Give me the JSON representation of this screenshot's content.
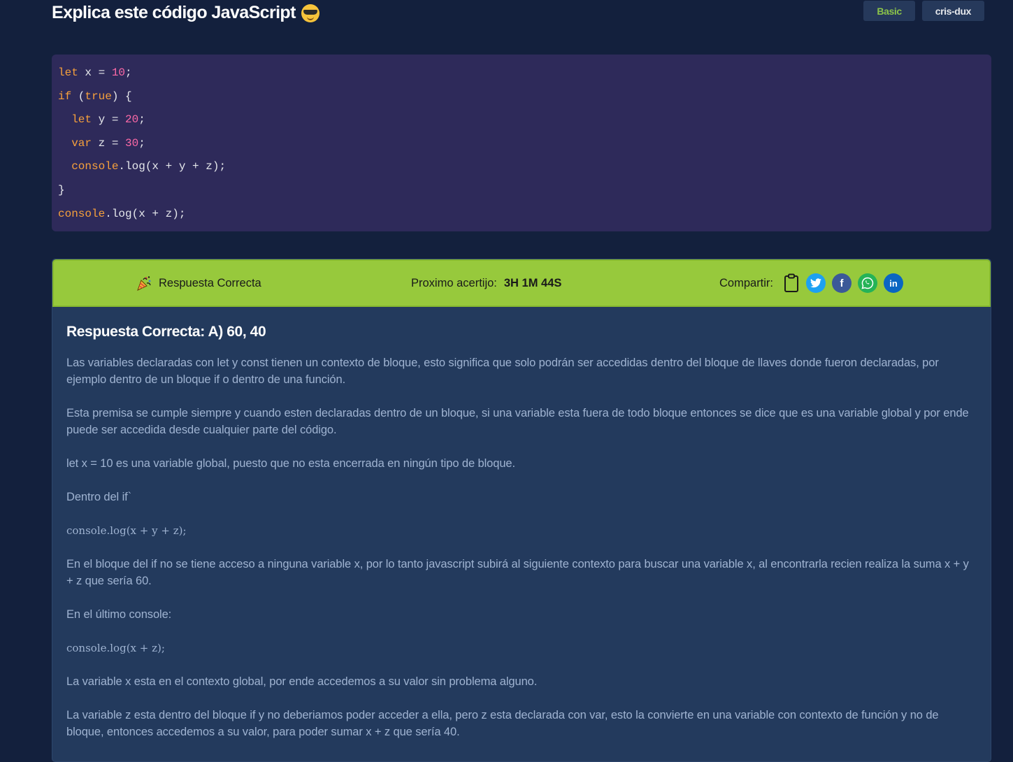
{
  "header": {
    "title": "Explica este código JavaScript",
    "level_badge": "Basic",
    "user_badge": "cris-dux"
  },
  "code": {
    "lines": [
      [
        {
          "t": "let",
          "c": "kw"
        },
        {
          "t": " x = "
        },
        {
          "t": "10",
          "c": "num"
        },
        {
          "t": ";"
        }
      ],
      [
        {
          "t": "if",
          "c": "kw"
        },
        {
          "t": " ("
        },
        {
          "t": "true",
          "c": "kw"
        },
        {
          "t": ") {"
        }
      ],
      [
        {
          "t": "  "
        },
        {
          "t": "let",
          "c": "kw"
        },
        {
          "t": " y = "
        },
        {
          "t": "20",
          "c": "num"
        },
        {
          "t": ";"
        }
      ],
      [
        {
          "t": "  "
        },
        {
          "t": "var",
          "c": "kw"
        },
        {
          "t": " z = "
        },
        {
          "t": "30",
          "c": "num"
        },
        {
          "t": ";"
        }
      ],
      [
        {
          "t": "  "
        },
        {
          "t": "console",
          "c": "obj"
        },
        {
          "t": ".log(x + y + z);"
        }
      ],
      [
        {
          "t": "}"
        }
      ],
      [
        {
          "t": "console",
          "c": "obj"
        },
        {
          "t": ".log(x + z);"
        }
      ]
    ]
  },
  "result_bar": {
    "status": "Respuesta Correcta",
    "next_label": "Proximo acertijo:",
    "countdown": "3H 1M 44S",
    "share_label": "Compartir:",
    "twitter": "t",
    "facebook": "f",
    "linkedin": "in"
  },
  "explanation": {
    "title": "Respuesta Correcta: A) 60, 40",
    "blocks": [
      {
        "type": "p",
        "text": "Las variables declaradas con let y const tienen un contexto de bloque, esto significa que solo podrán ser accedidas dentro del bloque de llaves donde fueron declaradas, por ejemplo dentro de un bloque if o dentro de una función."
      },
      {
        "type": "p",
        "text": "Esta premisa se cumple siempre y cuando esten declaradas dentro de un bloque, si una variable esta fuera de todo bloque entonces se dice que es una variable global y por ende puede ser accedida desde cualquier parte del código."
      },
      {
        "type": "p",
        "text": "let x = 10 es una variable global, puesto que no esta encerrada en ningún tipo de bloque."
      },
      {
        "type": "p",
        "text": "Dentro del if`"
      },
      {
        "type": "code",
        "text": "console.log(x + y + z);"
      },
      {
        "type": "p",
        "text": "En el bloque del if no se tiene acceso a ninguna variable x, por lo tanto javascript subirá al siguiente contexto para buscar una variable x, al encontrarla recien realiza la suma x + y + z que sería 60."
      },
      {
        "type": "p",
        "text": "En el último console:"
      },
      {
        "type": "code",
        "text": "console.log(x + z);"
      },
      {
        "type": "p",
        "text": "La variable x esta en el contexto global, por ende accedemos a su valor sin problema alguno."
      },
      {
        "type": "p",
        "text": "La variable z esta dentro del bloque if y no deberiamos poder acceder a ella, pero z esta declarada con var, esto la convierte en una variable con contexto de función y no de bloque, entonces accedemos a su valor, para poder sumar x + z que sería 40."
      }
    ]
  }
}
